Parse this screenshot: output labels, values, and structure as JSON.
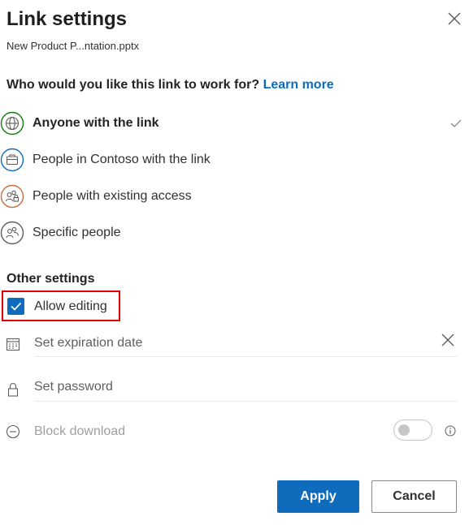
{
  "dialog": {
    "title": "Link settings",
    "filename": "New Product P...ntation.pptx"
  },
  "audience": {
    "question": "Who would you like this link to work for?",
    "learn_more": "Learn more",
    "options": [
      {
        "label": "Anyone with the link",
        "icon": "globe-icon",
        "selected": true
      },
      {
        "label": "People in Contoso with the link",
        "icon": "briefcase-icon",
        "selected": false
      },
      {
        "label": "People with existing access",
        "icon": "people-lock-icon",
        "selected": false
      },
      {
        "label": "Specific people",
        "icon": "people-icon",
        "selected": false
      }
    ]
  },
  "other_settings": {
    "heading": "Other settings",
    "allow_editing": {
      "label": "Allow editing",
      "checked": true
    },
    "expiration": {
      "placeholder": "Set expiration date"
    },
    "password": {
      "placeholder": "Set password"
    },
    "block_download": {
      "label": "Block download",
      "enabled": false
    }
  },
  "buttons": {
    "apply": "Apply",
    "cancel": "Cancel"
  },
  "colors": {
    "accent": "#0f6cbd",
    "highlight_border": "#e00000",
    "globe": "#107c10",
    "briefcase": "#0f6cbd",
    "people_lock": "#c86b3d",
    "people": "#605e5c"
  }
}
